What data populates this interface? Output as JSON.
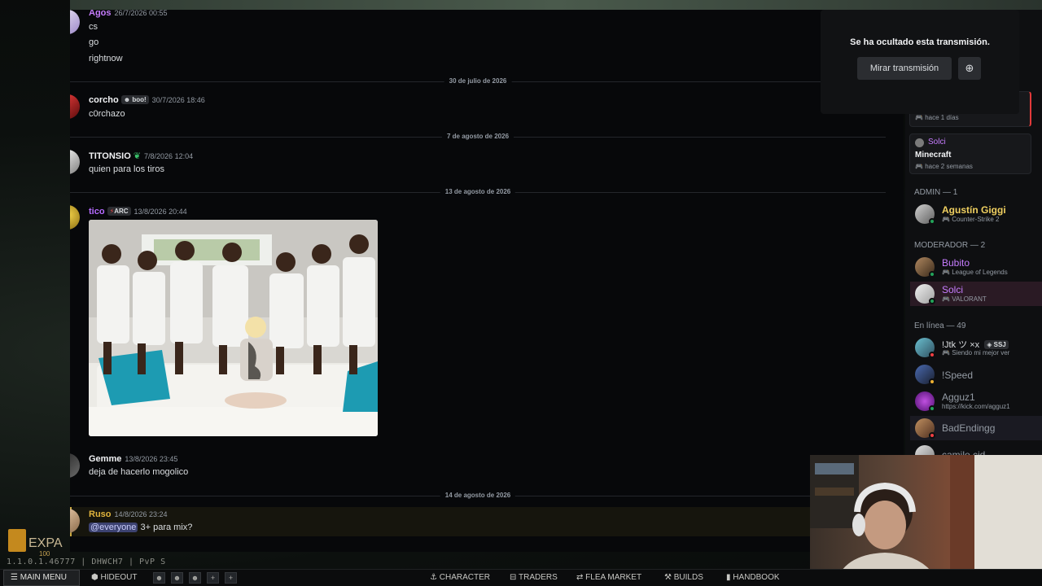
{
  "messages": {
    "agos": {
      "user": "Agos",
      "timestamp": "26/7/2026 00:55",
      "lines": [
        "cs",
        "go",
        "rightnow"
      ]
    },
    "divider1": "30 de julio de 2026",
    "corcho": {
      "user": "corcho",
      "tag": "boo!",
      "timestamp": "30/7/2026 18:46",
      "line": "c0rchazo"
    },
    "divider2": "7 de agosto de 2026",
    "titonsio": {
      "user": "TITONSIO",
      "timestamp": "7/8/2026 12:04",
      "line": "quien para los tiros"
    },
    "divider3": "13 de agosto de 2026",
    "tico": {
      "user": "tico",
      "tag": "ARC",
      "timestamp": "13/8/2026 20:44"
    },
    "gemme": {
      "user": "Gemme",
      "timestamp": "13/8/2026 23:45",
      "line": "deja de hacerlo mogolico"
    },
    "divider4": "14 de agosto de 2026",
    "ruso": {
      "user": "Ruso",
      "timestamp": "14/8/2026 23:24",
      "mention": "@everyone",
      "line": "3+ para mix?"
    }
  },
  "stream": {
    "title": "Se ha ocultado esta transmisión.",
    "watch_label": "Mirar transmisión"
  },
  "sidebar": {
    "card1_sub": "hace 1 días",
    "card2": {
      "user": "Solci",
      "game": "Minecraft",
      "sub": "hace 2 semanas"
    },
    "admin_header": "ADMIN — 1",
    "admin": [
      {
        "name": "Agustín Giggi",
        "activity": "Counter-Strike 2"
      }
    ],
    "mod_header": "MODERADOR — 2",
    "mods": [
      {
        "name": "Bubito",
        "activity": "League of Legends"
      },
      {
        "name": "Solci",
        "activity": "VALORANT"
      }
    ],
    "online_header": "En línea — 49",
    "online": [
      {
        "name": "!Jtk ツ ×x",
        "tag": "SSJ",
        "activity": "Siendo mi mejor ver"
      },
      {
        "name": "!Speed",
        "activity": ""
      },
      {
        "name": "Agguz1",
        "activity": "https://kick.com/agguz1"
      },
      {
        "name": "BadEndingg",
        "activity": ""
      },
      {
        "name": "camilo cid",
        "activity": ""
      }
    ]
  },
  "game": {
    "hud_text": "EXPA",
    "hud_small": "100",
    "version": "1.1.0.1.46777 | DHWCH7 | PvP S",
    "main_menu": "MAIN MENU",
    "hideout": "HIDEOUT",
    "character": "CHARACTER",
    "traders": "TRADERS",
    "flea": "FLEA MARKET",
    "builds": "BUILDS",
    "handbook": "HANDBOOK"
  },
  "colors": {
    "agos": "#c77dff",
    "corcho": "#f2f3f5",
    "titonsio": "#f2f3f5",
    "tico": "#b56bff",
    "gemme": "#f2f3f5",
    "ruso": "#e2b53d",
    "admin": "#f0d060",
    "mod": "#c77dff"
  }
}
